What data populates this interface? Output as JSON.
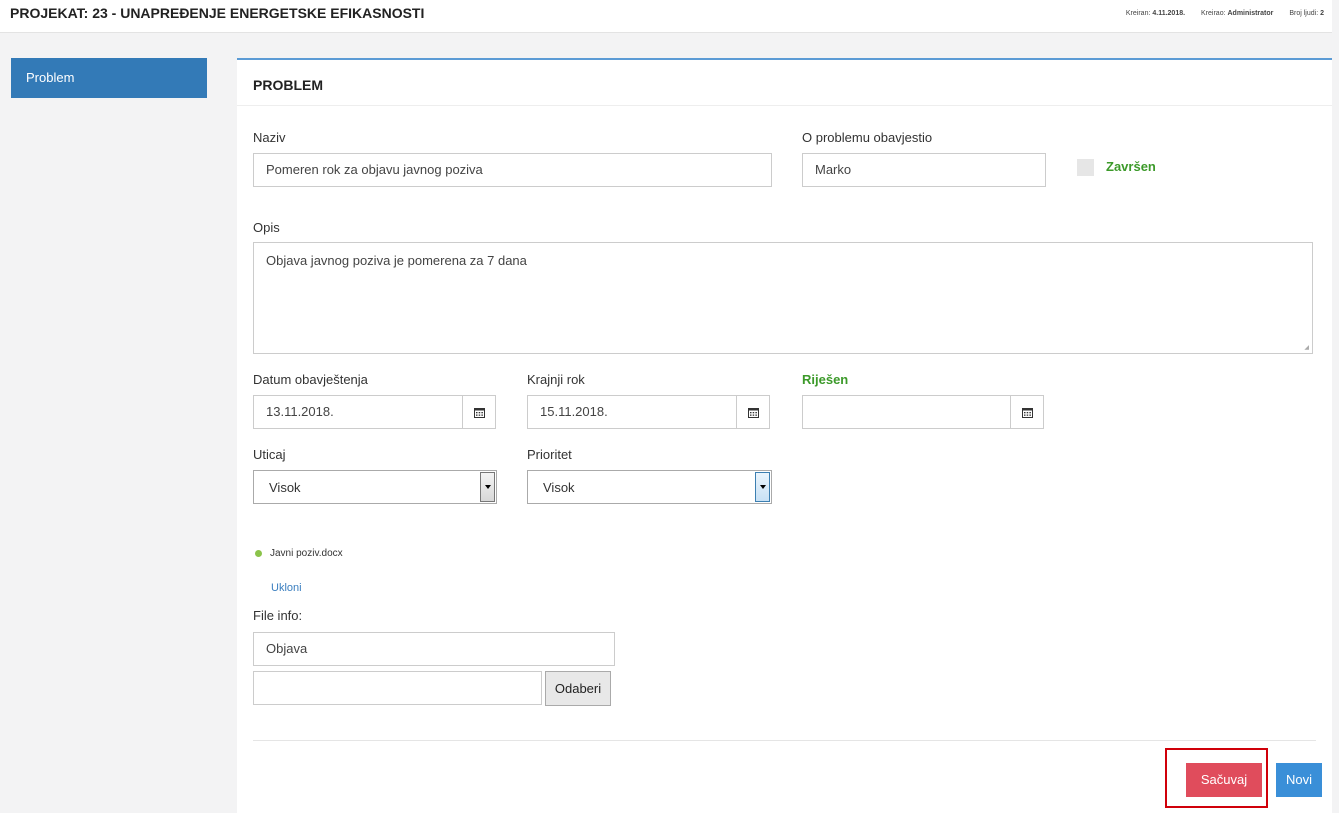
{
  "header": {
    "title": "PROJEKAT: 23 - UNAPREĐENJE ENERGETSKE EFIKASNOSTI",
    "created_label": "Kreiran:",
    "created_value": "4.11.2018.",
    "author_label": "Kreirao:",
    "author_value": "Administrator",
    "people_label": "Broj ljudi:",
    "people_value": "2"
  },
  "sidebar": {
    "items": [
      {
        "label": "Problem"
      }
    ]
  },
  "panel": {
    "title": "PROBLEM",
    "naziv_label": "Naziv",
    "naziv_value": "Pomeren rok za objavu javnog poziva",
    "reporter_label": "O problemu obavjestio",
    "reporter_value": "Marko",
    "zavrsen_label": "Završen",
    "opis_label": "Opis",
    "opis_value": "Objava javnog poziva je pomerena za 7 dana",
    "datum_label": "Datum obavještenja",
    "datum_value": "13.11.2018.",
    "krajnji_label": "Krajnji rok",
    "krajnji_value": "15.11.2018.",
    "rijesen_label": "Riješen",
    "rijesen_value": "",
    "uticaj_label": "Uticaj",
    "uticaj_value": "Visok",
    "prioritet_label": "Prioritet",
    "prioritet_value": "Visok",
    "file_name": "Javni poziv.docx",
    "remove_label": "Ukloni",
    "file_info_label": "File info:",
    "file_info_value": "Objava",
    "upload_value": "",
    "browse_label": "Odaberi",
    "save_label": "Sačuvaj",
    "new_label": "Novi"
  },
  "colors": {
    "accent_blue": "#337ab7",
    "success_green": "#3c9a2a",
    "save_red": "#e04c5c",
    "new_blue": "#3a8fd8",
    "highlight_red": "#d0000a"
  }
}
